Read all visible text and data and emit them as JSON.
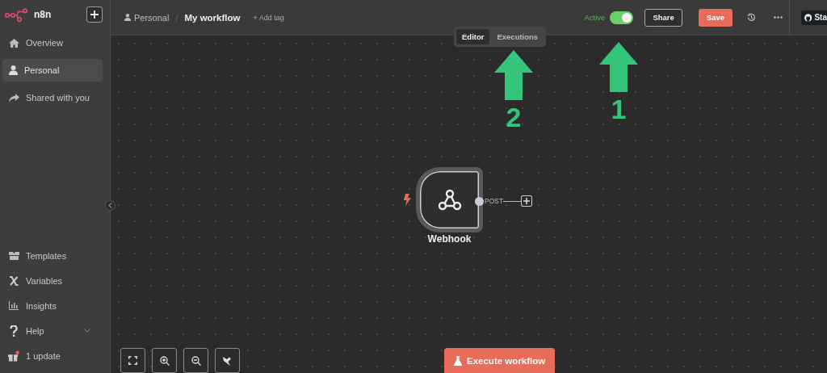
{
  "sidebar": {
    "logo": "n8n",
    "items": [
      {
        "label": "Overview",
        "selected": false
      },
      {
        "label": "Personal",
        "selected": true
      },
      {
        "label": "Shared with you",
        "selected": false
      }
    ],
    "bottom_items": [
      {
        "label": "Templates",
        "kind": "link"
      },
      {
        "label": "Variables",
        "kind": "link"
      },
      {
        "label": "Insights",
        "kind": "link"
      },
      {
        "label": "Help",
        "kind": "menu"
      },
      {
        "label": "1 update",
        "kind": "update"
      }
    ]
  },
  "header": {
    "breadcrumb": {
      "project": "Personal",
      "separator": "/",
      "workflow": "My workflow"
    },
    "add_tag": "+ Add tag",
    "active": {
      "label": "Active",
      "on": true
    },
    "buttons": [
      "Share",
      "Save"
    ],
    "github": "Sta"
  },
  "canvas": {
    "tabs": [
      {
        "label": "Editor",
        "selected": true
      },
      {
        "label": "Executions",
        "selected": false
      }
    ],
    "node": {
      "name": "Webhook",
      "output": "POST"
    },
    "annotations": [
      {
        "label": "1"
      },
      {
        "label": "2"
      }
    ],
    "execute": "Execute workflow"
  }
}
